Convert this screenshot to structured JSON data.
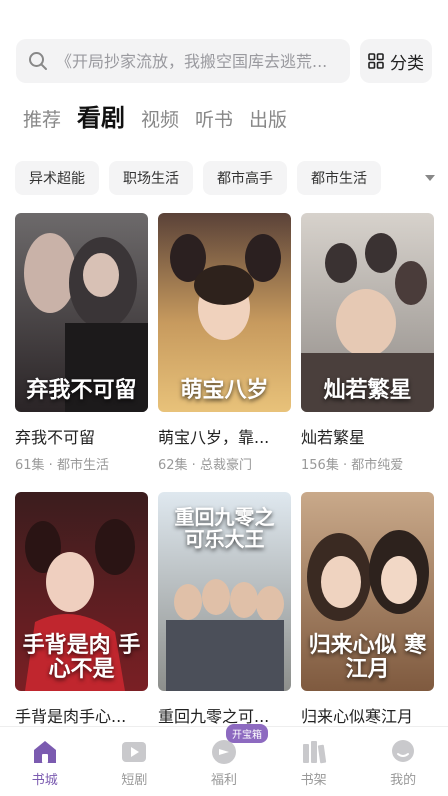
{
  "search": {
    "placeholder": "《开局抄家流放，我搬空国库去逃荒...",
    "category_label": "分类"
  },
  "tabs": [
    {
      "label": "推荐",
      "active": false
    },
    {
      "label": "看剧",
      "active": true
    },
    {
      "label": "视频",
      "active": false
    },
    {
      "label": "听书",
      "active": false
    },
    {
      "label": "出版",
      "active": false
    }
  ],
  "chips": [
    "异术超能",
    "职场生活",
    "都市高手",
    "都市生活"
  ],
  "cards": [
    {
      "title": "弃我不可留",
      "meta": "61集 · 都市生活",
      "poster_text": "弃我不可留"
    },
    {
      "title": "萌宝八岁，靠...",
      "meta": "62集 · 总裁豪门",
      "poster_text": "萌宝八岁"
    },
    {
      "title": "灿若繁星",
      "meta": "156集 · 都市纯爱",
      "poster_text": "灿若繁星"
    },
    {
      "title": "手背是肉手心...",
      "meta": "",
      "poster_text": "手背是肉 手心不是"
    },
    {
      "title": "重回九零之可...",
      "meta": "",
      "poster_text": "重回九零之 可乐大王"
    },
    {
      "title": "归来心似寒江月",
      "meta": "",
      "poster_text": "归来心似 寒江月"
    }
  ],
  "nav": {
    "items": [
      {
        "label": "书城",
        "icon": "home-icon",
        "active": true
      },
      {
        "label": "短剧",
        "icon": "play-icon",
        "active": false
      },
      {
        "label": "福利",
        "icon": "gift-icon",
        "active": false
      },
      {
        "label": "书架",
        "icon": "bookshelf-icon",
        "active": false
      },
      {
        "label": "我的",
        "icon": "profile-icon",
        "active": false
      }
    ],
    "welfare_badge": "开宝箱"
  },
  "colors": {
    "accent": "#7b5bb0",
    "badge": "#8d6ac0"
  }
}
